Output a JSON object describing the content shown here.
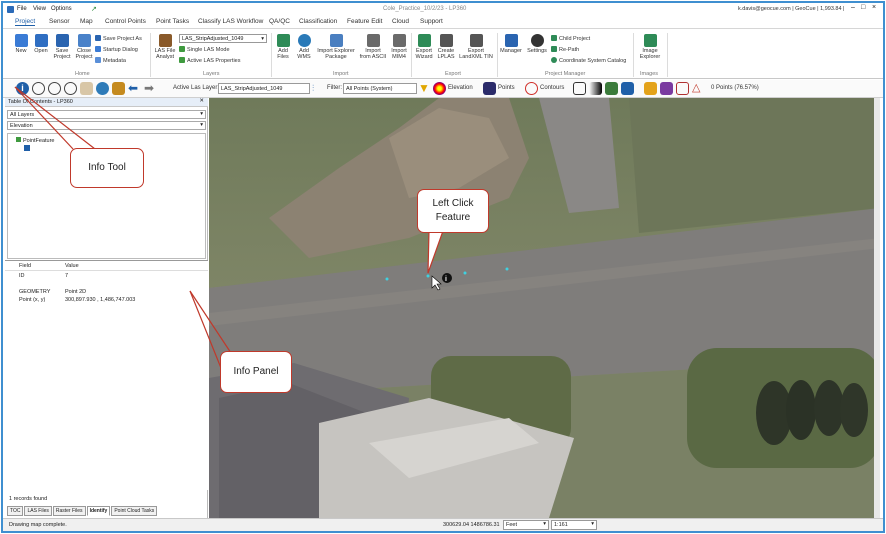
{
  "titlebar": {
    "menus": [
      "File",
      "View",
      "Options"
    ],
    "title": "Cole_Practice_10/2/23 - LP360",
    "user": "k.davis@geocue.com  |  GeoCue  |  1,993.84  |",
    "controls": [
      "–",
      "□",
      "×"
    ]
  },
  "menu_tabs": [
    "Project",
    "Sensor",
    "Map",
    "Control Points",
    "Point Tasks",
    "Classify LAS Workflow",
    "QA/QC",
    "Classification",
    "Feature Edit",
    "Cloud",
    "Support"
  ],
  "ribbon": {
    "home_buttons": [
      "New",
      "Open",
      "Save\nProject",
      "Close\nProject"
    ],
    "home_small": [
      "Save Project As",
      "Startup Dialog",
      "Metadata"
    ],
    "home_group": "Home",
    "las_file_analyst": "LAS File\nAnalyst",
    "layer_select": "LAS_StripAdjusted_1049",
    "layers_small": [
      "Single LAS Mode",
      "Active LAS Properties"
    ],
    "layers_group": "Layers",
    "import_buttons": [
      "Add\nFiles",
      "Add\nWMS",
      "Import Explorer\nPackage",
      "Import\nfrom ASCII",
      "Import\nMIM4"
    ],
    "import_group": "Import",
    "export_buttons": [
      "Export\nWizard",
      "Create\nLPLAS",
      "Export\nLandXML TIN"
    ],
    "export_group": "Export",
    "pm_buttons": [
      "Manager",
      "Settings"
    ],
    "pm_small": [
      "Child Project",
      "Re-Path",
      "Coordinate System Catalog"
    ],
    "pm_group": "Project Manager",
    "images_button": "Image\nExplorer",
    "images_group": "Images"
  },
  "toolbar": {
    "active_las_label": "Active Las Layer:",
    "active_las_value": "LAS_StripAdjusted_1049",
    "filter_label": "Filter:",
    "filter_value": "All Points (System)",
    "elevation": "Elevation",
    "points": "Points",
    "contours": "Contours",
    "point_count": "0 Points (76.57%)"
  },
  "left_panel": {
    "header": "Table Of Contents - LP360",
    "layer_select": "All Layers",
    "sub_select": "Elevation",
    "tree_item": "PointFeature",
    "field_header": "Field",
    "value_header": "Value",
    "rows": [
      {
        "field": "ID",
        "value": "7"
      },
      {
        "field": "GEOMETRY",
        "value": "Point 2D"
      },
      {
        "field": "Point (x, y)",
        "value": "300,897.930 , 1,486,747.003"
      }
    ],
    "records_found": "1 records found",
    "tabs": [
      "TOC",
      "LAS Files",
      "Raster Files",
      "Identify",
      "Point Cloud Tasks"
    ],
    "active_tab": "Identify"
  },
  "status": {
    "left": "Drawing map complete.",
    "coords": "300629.04  1486786.31",
    "units": "Feet",
    "scale": "1:161"
  },
  "callouts": {
    "info_tool": "Info Tool",
    "left_click": "Left Click\nFeature",
    "info_panel": "Info Panel"
  },
  "colors": {
    "callout_border": "#c0392b",
    "accent_blue": "#1f5fa8",
    "frame_border": "#3f8fd0",
    "feature_point": "#3fd1e0"
  }
}
